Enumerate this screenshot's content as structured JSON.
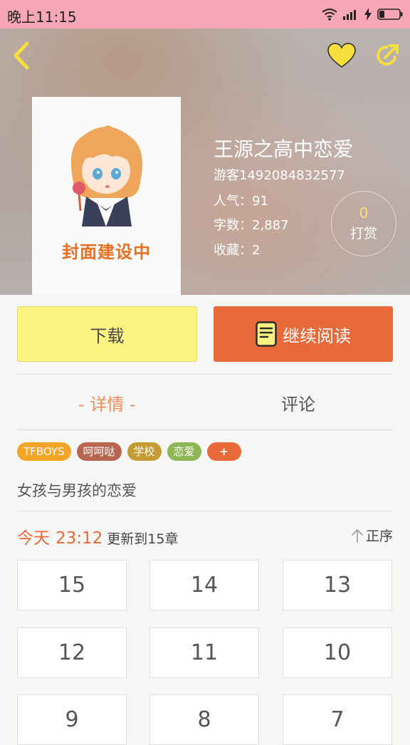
{
  "status_bar": {
    "time": "晚上11:15"
  },
  "book": {
    "cover_caption": "封面建设中",
    "title": "王源之高中恋爱",
    "author": "游客1492084832577",
    "popularity": "人气：91",
    "word_count": "字数：2,887",
    "favorites": "收藏：2"
  },
  "reward": {
    "count": "0",
    "label": "打赏"
  },
  "actions": {
    "download_label": "下载",
    "read_label": "继续阅读"
  },
  "tabs": {
    "details": "- 详情 -",
    "comments": "评论"
  },
  "tags": [
    {
      "label": "TFBOYS",
      "color": "#f5a425"
    },
    {
      "label": "呵呵哒",
      "color": "#b8664f"
    },
    {
      "label": "学校",
      "color": "#c49b35"
    },
    {
      "label": "恋爱",
      "color": "#8db655"
    },
    {
      "label": "+",
      "color": "#e8693a"
    }
  ],
  "description": "女孩与男孩的恋爱",
  "update": {
    "day": "今天",
    "time": "23:12",
    "info": "更新到15章"
  },
  "sort_label": "正序",
  "chapters": [
    "15",
    "14",
    "13",
    "12",
    "11",
    "10",
    "9",
    "8",
    "7"
  ],
  "colors": {
    "accent": "#e8693a",
    "status_bar": "#f7a7b6",
    "icon_yellow": "#f6df3d",
    "download": "#fdf381"
  }
}
